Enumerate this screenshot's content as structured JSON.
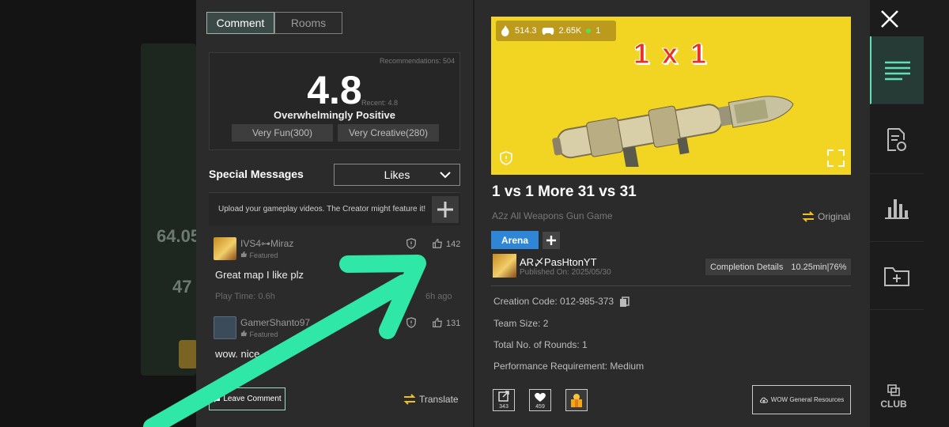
{
  "background": {
    "score_partial": "64.05",
    "count_partial": "47"
  },
  "left": {
    "tabs": [
      {
        "label": "Comment",
        "active": true
      },
      {
        "label": "Rooms",
        "active": false
      }
    ],
    "rating": {
      "recommendations": "Recommendations: 504",
      "score": "4.8",
      "recent": "Recent: 4.8",
      "sentiment": "Overwhelmingly Positive",
      "tags": [
        "Very Fun(300)",
        "Very Creative(280)"
      ]
    },
    "special_messages_label": "Special Messages",
    "sort_value": "Likes",
    "upload_text": "Upload your gameplay videos. The Creator might feature it!",
    "comments": [
      {
        "user": "IVS4⊶Miraz",
        "featured": "Featured",
        "likes": "142",
        "text": "Great map I like plz",
        "play_time": "Play Time: 0.6h",
        "ago": "6h ago"
      },
      {
        "user": "GamerShanto97",
        "featured": "Featured",
        "likes": "131",
        "text": "wow. nice"
      }
    ],
    "leave_comment": "Leave Comment",
    "translate": "Translate"
  },
  "right": {
    "banner": {
      "heat": "514.3",
      "players": "2.65K",
      "online": "1",
      "title": "1 x 1",
      "bg_color": "#f2d422"
    },
    "map_title": "1 vs 1 More 31 vs 31",
    "subtitle": "A2z All Weapons Gun Game",
    "original": "Original",
    "tag": "Arena",
    "creator": "AR〆PasHtonYT",
    "published": "Published On: 2025/05/30",
    "completion_label": "Completion Details",
    "completion_value": "10.25min|76%",
    "info": [
      "Creation Code: 012-985-373",
      "Team Size: 2",
      "Total No. of Rounds: 1",
      "Performance Requirement: Medium"
    ],
    "actions": [
      {
        "icon": "share-icon",
        "count": "343"
      },
      {
        "icon": "heart-icon",
        "count": "459"
      },
      {
        "icon": "gift-icon",
        "count": ""
      }
    ],
    "resources_label": "WOW General Resources"
  },
  "sidenav": {
    "items": [
      "list-icon",
      "document-refresh-icon",
      "bar-chart-icon",
      "folder-add-icon"
    ],
    "club_label": "CLUB"
  },
  "colors": {
    "accent": "#5fe0b8",
    "arrow": "#2fe8a8",
    "arena": "#2f86d6"
  }
}
